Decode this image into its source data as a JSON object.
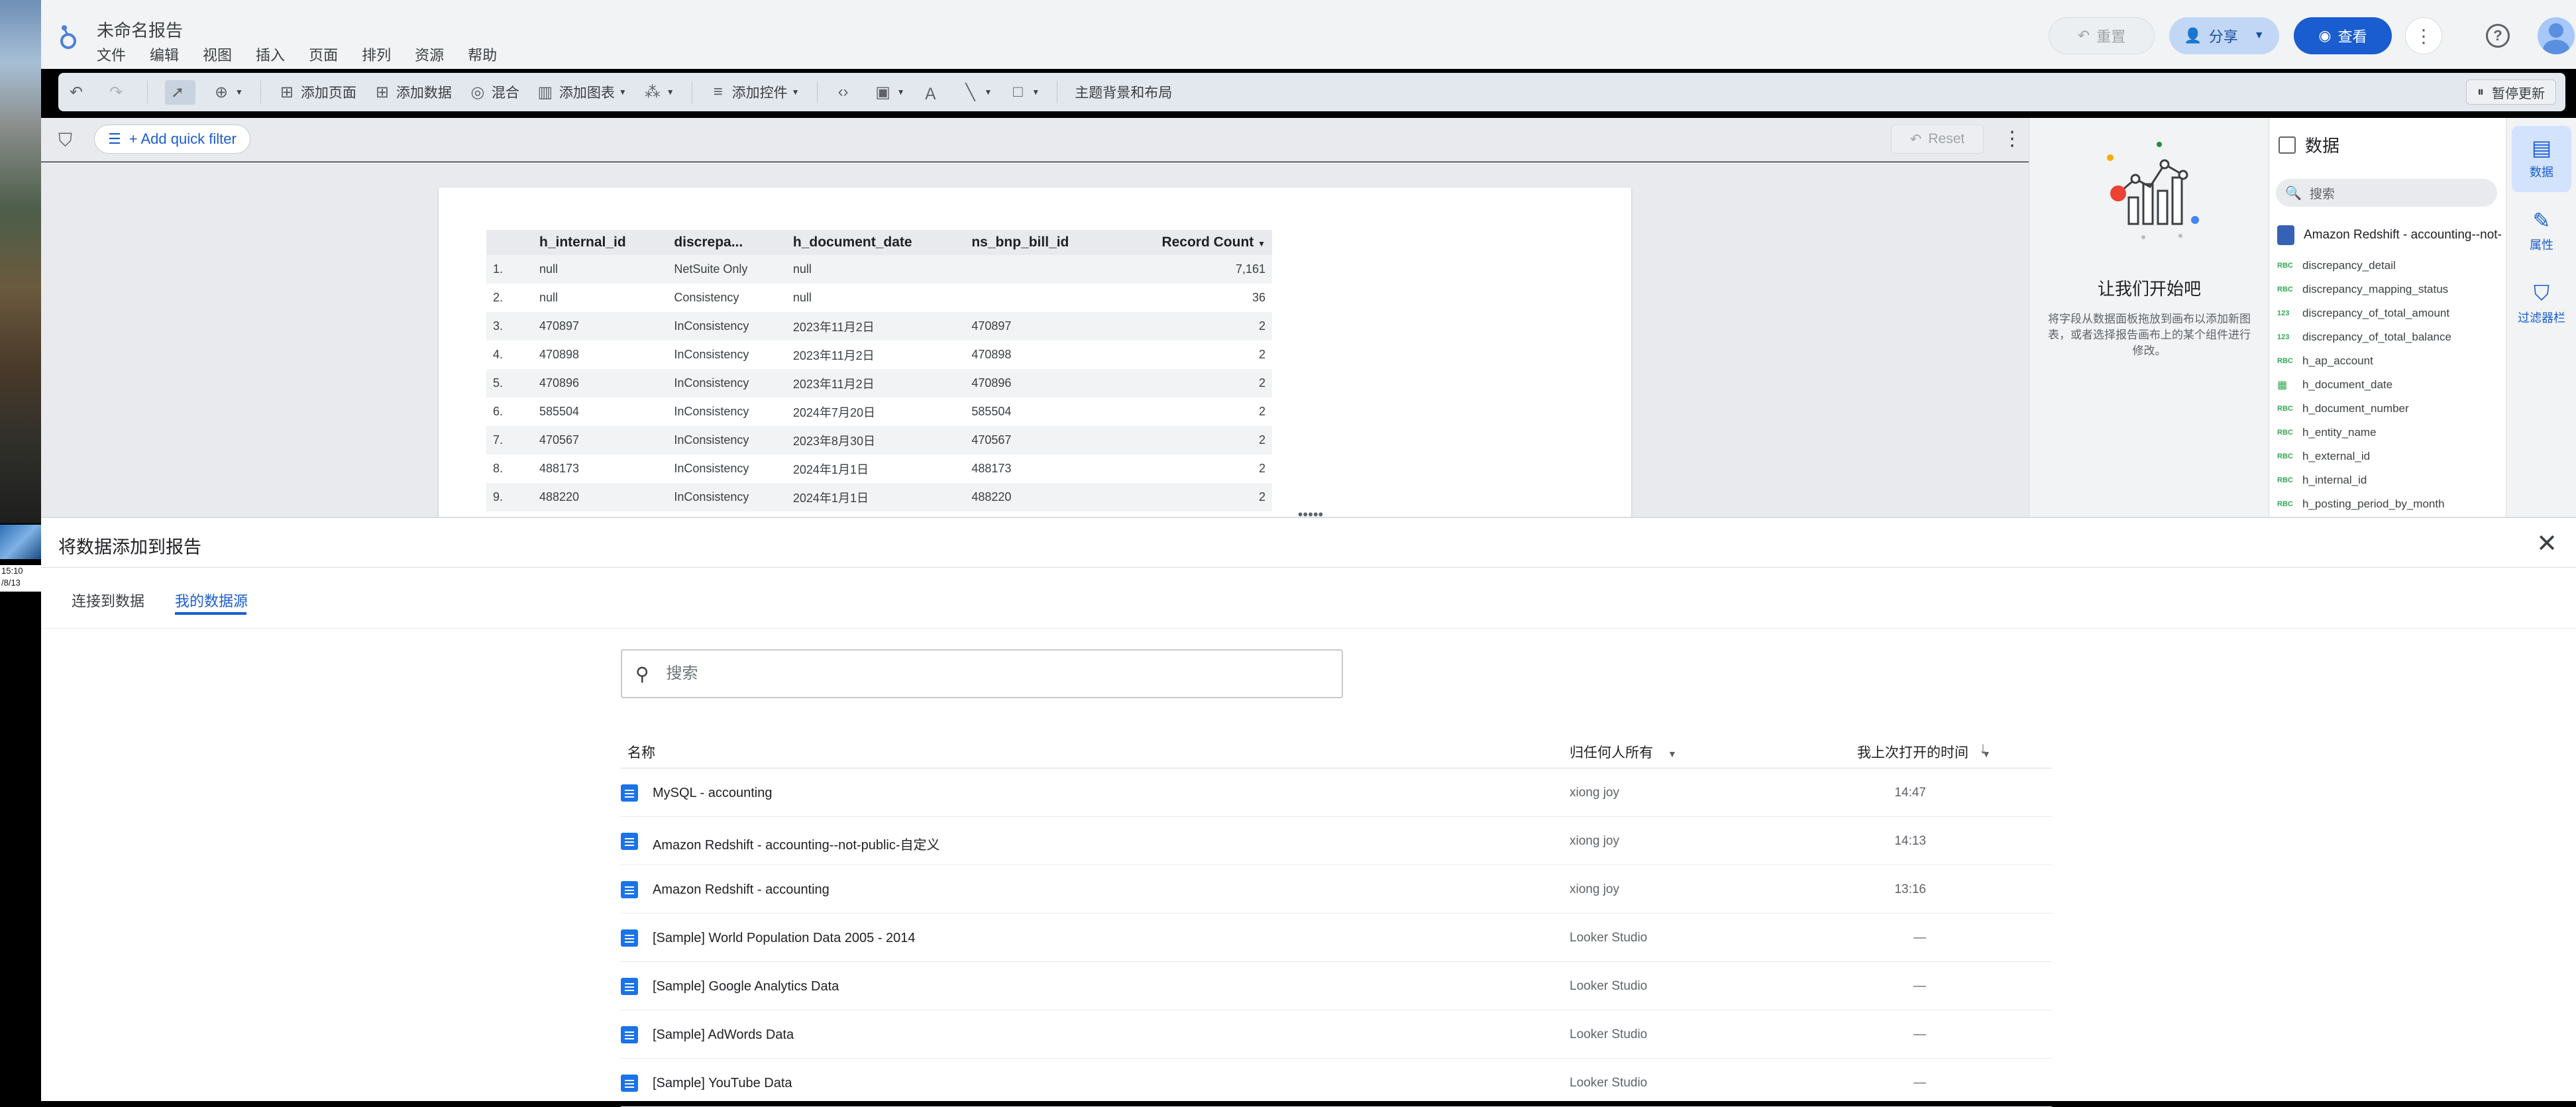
{
  "desktop": {
    "clock_time": "15:10",
    "clock_date": "/8/13"
  },
  "app": {
    "doc_title": "未命名报告",
    "menu": [
      "文件",
      "编辑",
      "视图",
      "插入",
      "页面",
      "排列",
      "资源",
      "帮助"
    ],
    "reset_label": "重置",
    "share_label": "分享",
    "view_label": "查看"
  },
  "toolbar": {
    "add_page": "添加页面",
    "add_data": "添加数据",
    "blend": "混合",
    "add_chart": "添加图表",
    "add_control": "添加控件",
    "theme": "主题背景和布局",
    "pause": "暂停更新"
  },
  "filterbar": {
    "quick_filter": "+ Add quick filter",
    "reset": "Reset"
  },
  "report_table": {
    "headers": [
      "h_internal_id",
      "discrepa...",
      "h_document_date",
      "ns_bnp_bill_id",
      "Record Count"
    ],
    "rows": [
      [
        "1.",
        "null",
        "NetSuite Only",
        "null",
        "",
        "7,161"
      ],
      [
        "2.",
        "null",
        "Consistency",
        "null",
        "",
        "36"
      ],
      [
        "3.",
        "470897",
        "InConsistency",
        "2023年11月2日",
        "470897",
        "2"
      ],
      [
        "4.",
        "470898",
        "InConsistency",
        "2023年11月2日",
        "470898",
        "2"
      ],
      [
        "5.",
        "470896",
        "InConsistency",
        "2023年11月2日",
        "470896",
        "2"
      ],
      [
        "6.",
        "585504",
        "InConsistency",
        "2024年7月20日",
        "585504",
        "2"
      ],
      [
        "7.",
        "470567",
        "InConsistency",
        "2023年8月30日",
        "470567",
        "2"
      ],
      [
        "8.",
        "488173",
        "InConsistency",
        "2024年1月1日",
        "488173",
        "2"
      ],
      [
        "9.",
        "488220",
        "InConsistency",
        "2024年1月1日",
        "488220",
        "2"
      ]
    ]
  },
  "start_panel": {
    "title": "让我们开始吧",
    "description": "将字段从数据面板拖放到画布以添加新图表，或者选择报告画布上的某个组件进行修改。"
  },
  "data_panel": {
    "title": "数据",
    "search_placeholder": "搜索",
    "source": "Amazon Redshift - accounting--not-p...",
    "fields": [
      {
        "type": "RBC",
        "name": "discrepancy_detail"
      },
      {
        "type": "RBC",
        "name": "discrepancy_mapping_status"
      },
      {
        "type": "123",
        "name": "discrepancy_of_total_amount"
      },
      {
        "type": "123",
        "name": "discrepancy_of_total_balance"
      },
      {
        "type": "RBC",
        "name": "h_ap_account"
      },
      {
        "type": "cal",
        "name": "h_document_date"
      },
      {
        "type": "RBC",
        "name": "h_document_number"
      },
      {
        "type": "RBC",
        "name": "h_entity_name"
      },
      {
        "type": "RBC",
        "name": "h_external_id"
      },
      {
        "type": "RBC",
        "name": "h_internal_id"
      },
      {
        "type": "RBC",
        "name": "h_posting_period_by_month"
      }
    ]
  },
  "side_tabs": {
    "data": "数据",
    "props": "属性",
    "filterbar": "过滤器栏"
  },
  "sheet": {
    "title": "将数据添加到报告",
    "tab_connect": "连接到数据",
    "tab_mine": "我的数据源",
    "search_placeholder": "搜索",
    "col_name": "名称",
    "col_owner": "归任何人所有",
    "col_opened": "我上次打开的时间",
    "rows": [
      {
        "name": "MySQL - accounting",
        "owner": "xiong joy",
        "time": "14:47"
      },
      {
        "name": "Amazon Redshift - accounting--not-public-自定义",
        "owner": "xiong joy",
        "time": "14:13"
      },
      {
        "name": "Amazon Redshift - accounting",
        "owner": "xiong joy",
        "time": "13:16"
      },
      {
        "name": "[Sample] World Population Data 2005 - 2014",
        "owner": "Looker Studio",
        "time": "—"
      },
      {
        "name": "[Sample] Google Analytics Data",
        "owner": "Looker Studio",
        "time": "—"
      },
      {
        "name": "[Sample] AdWords Data",
        "owner": "Looker Studio",
        "time": "—"
      },
      {
        "name": "[Sample] YouTube Data",
        "owner": "Looker Studio",
        "time": "—"
      }
    ]
  }
}
